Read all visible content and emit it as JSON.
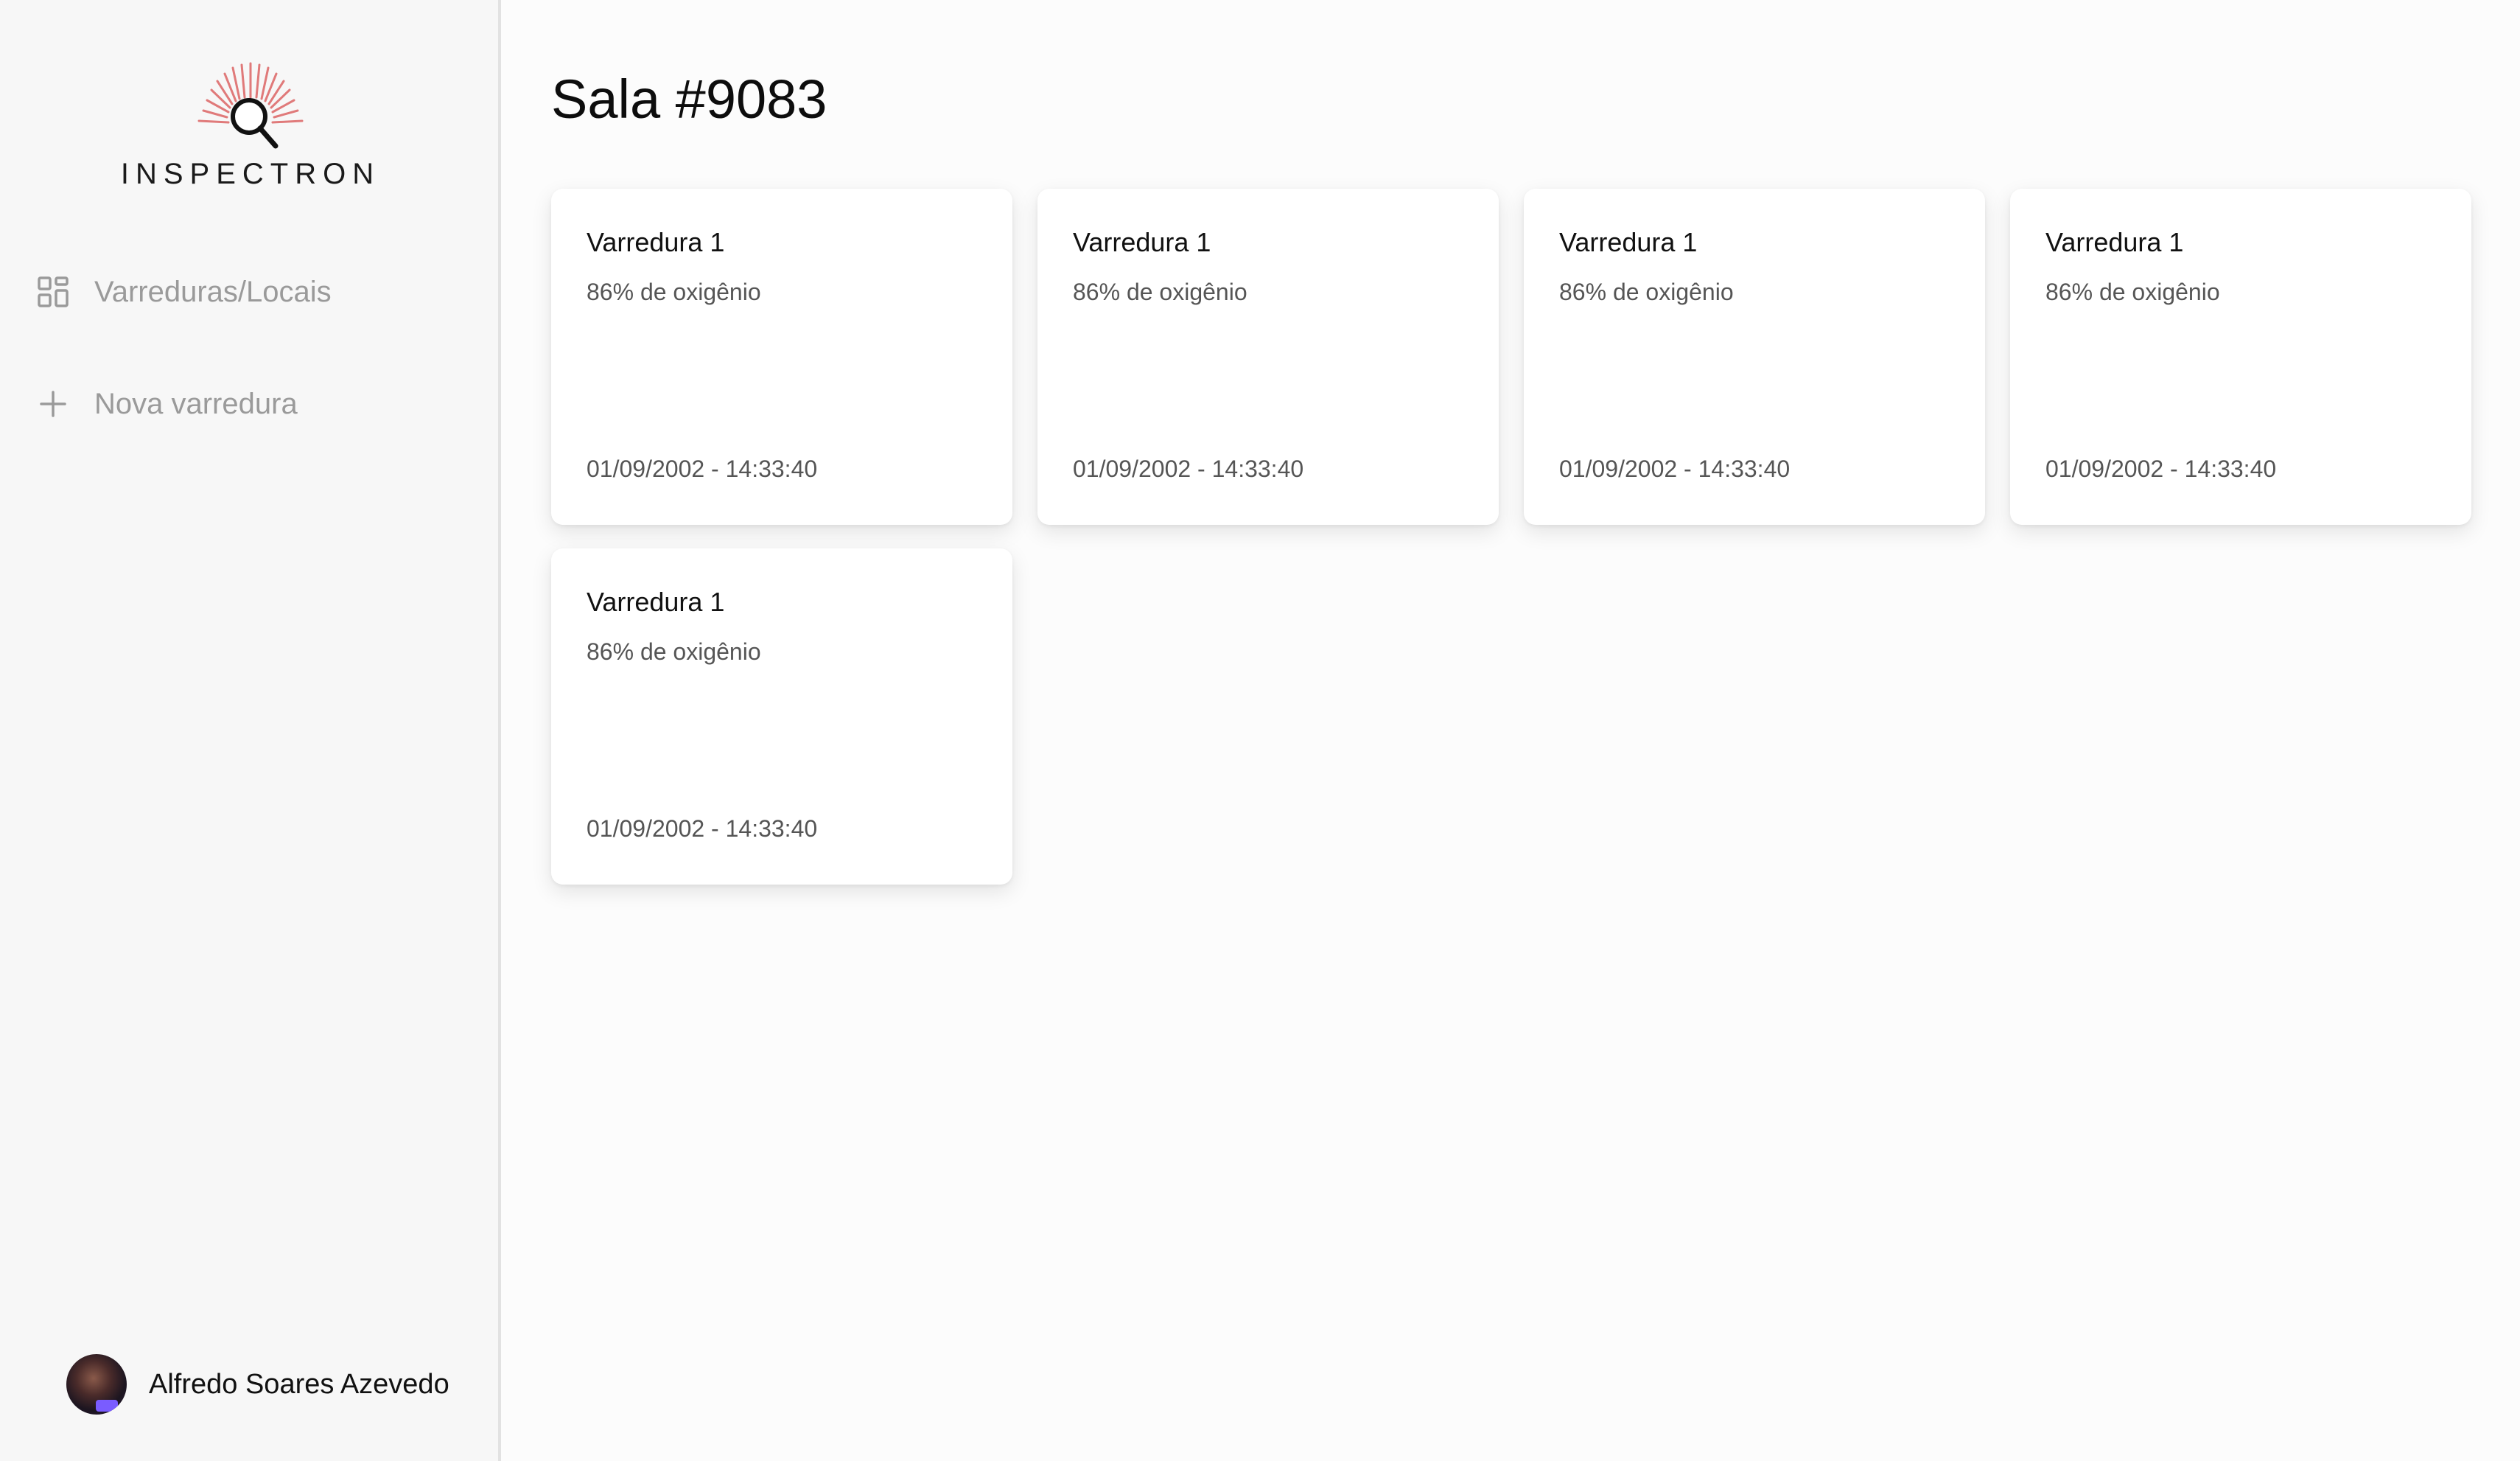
{
  "sidebar": {
    "logo_text": "INSPECTRON",
    "items": [
      {
        "label": "Varreduras/Locais",
        "icon": "grid-icon"
      },
      {
        "label": "Nova varredura",
        "icon": "plus-icon"
      }
    ],
    "user": {
      "name": "Alfredo Soares Azevedo"
    }
  },
  "main": {
    "title": "Sala #9083",
    "cards": [
      {
        "title": "Varredura 1",
        "subtitle": "86% de oxigênio",
        "date": "01/09/2002 - 14:33:40"
      },
      {
        "title": "Varredura 1",
        "subtitle": "86% de oxigênio",
        "date": "01/09/2002 - 14:33:40"
      },
      {
        "title": "Varredura 1",
        "subtitle": "86% de oxigênio",
        "date": "01/09/2002 - 14:33:40"
      },
      {
        "title": "Varredura 1",
        "subtitle": "86% de oxigênio",
        "date": "01/09/2002 - 14:33:40"
      },
      {
        "title": "Varredura 1",
        "subtitle": "86% de oxigênio",
        "date": "01/09/2002 - 14:33:40"
      }
    ]
  },
  "colors": {
    "logo_rays": "#e07a7a",
    "sidebar_bg": "#f7f7f7",
    "main_bg": "#fcfcfc",
    "nav_text": "#9a9a9a"
  }
}
